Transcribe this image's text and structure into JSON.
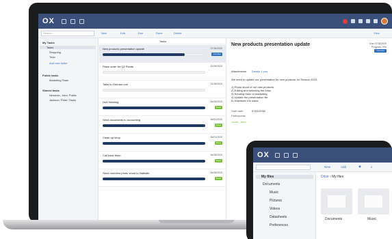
{
  "laptop": {
    "logo": "OX",
    "subbar": {
      "search_placeholder": "Search...",
      "toolbar": [
        "New",
        "Edit",
        "Due",
        "Done",
        "Delete"
      ],
      "view_label": "View"
    },
    "leftnav": {
      "my_tasks": "My Tasks",
      "items": [
        "Tasks",
        "Shopping",
        "Todo"
      ],
      "add_folder": "Add new folder",
      "public_tasks": "Public tasks",
      "public_items": [
        "Marketing Team"
      ],
      "shared_tasks": "Shared tasks",
      "shared_items": [
        "Newman, John, Public",
        "Jackson, Peter: Tasks"
      ]
    },
    "list": {
      "header": "Tasks",
      "tasks": [
        {
          "title": "New products presentation update",
          "date": "07/18/2020",
          "badge": "Overdue",
          "badge_color": "#2f6fbf",
          "progress": 0.8
        },
        {
          "title": "Place order for Q2 Plants",
          "date": "10/26/2020",
          "badge": "",
          "badge_color": "",
          "progress": 0
        },
        {
          "title": "Talks to German unit",
          "date": "12/18/2020",
          "badge": "",
          "badge_color": "",
          "progress": 0
        },
        {
          "title": "HoD Meeting",
          "date": "06/25/2020",
          "badge": "Done",
          "badge_color": "#7bbf3a",
          "progress": 1
        },
        {
          "title": "Send documents to accounting",
          "date": "06/01/2020",
          "badge": "Done",
          "badge_color": "#7bbf3a",
          "progress": 1
        },
        {
          "title": "Clean up shop",
          "date": "06/01/2020",
          "badge": "Done",
          "badge_color": "#7bbf3a",
          "progress": 1
        },
        {
          "title": "Call back Mom",
          "date": "06/28/2020",
          "badge": "Done",
          "badge_color": "#7bbf3a",
          "progress": 1
        },
        {
          "title": "Send overview photo shoot to Nathalie",
          "date": "06/28/2020",
          "badge": "Done",
          "badge_color": "#7bbf3a",
          "progress": 1
        }
      ]
    },
    "detail": {
      "title": "New products presentation update",
      "due": "Due 07/18/2020",
      "progress": "Progress 75%",
      "status": "Overdue",
      "attachments_label": "Attachments",
      "attachments_value": "Details 1 pos",
      "body_intro": "We need to update our presentation for new products for Season 2019:",
      "body_lines": [
        "1) Photo shoot of our new products",
        "2) Editing and selecting the fotos",
        "3) Sending them to marketing",
        "4) Update the presentation file",
        "5) Distribute it to sales"
      ],
      "start_label": "Start date",
      "start_value": "07/01/2020",
      "participants_label": "Participants",
      "participant": "Jones, John"
    }
  },
  "tablet": {
    "logo": "OX",
    "toolbar": [
      "New",
      "Add"
    ],
    "breadcrumb_root": "Drive",
    "breadcrumb_current": "My files",
    "leftnav": {
      "my_files": "My files",
      "items": [
        "Documents",
        "Music",
        "Pictures",
        "Videos",
        "Datasheets",
        "Preferences"
      ]
    },
    "folders": [
      "Documents",
      "Music"
    ]
  }
}
